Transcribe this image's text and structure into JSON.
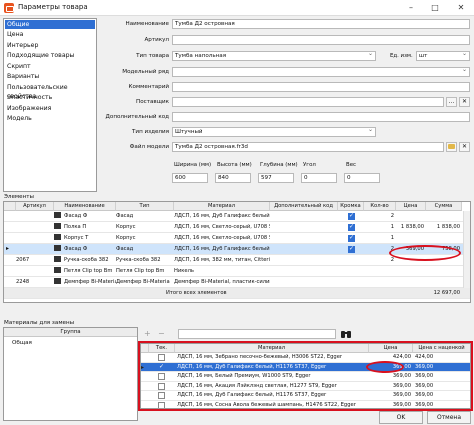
{
  "window": {
    "title": "Параметры товара",
    "minimize": "–",
    "maximize": "□",
    "close": "✕"
  },
  "nav": {
    "items": [
      "Общие",
      "Цена",
      "Интерьер",
      "Подходящие товары",
      "Скрипт",
      "Варианты",
      "Пользовательские свойства",
      "Эластичность",
      "Изображения",
      "Модель"
    ],
    "selected": 0
  },
  "form": {
    "name_label": "Наименование",
    "name_value": "Тумба Д2 островная",
    "article_label": "Артикул",
    "article_value": "",
    "type_label": "Тип товара",
    "type_value": "Тумба напольная",
    "unit_label": "Ед. изм.",
    "unit_value": "шт",
    "model_row_label": "Модельный ряд",
    "model_row_value": "",
    "comment_label": "Комментарий",
    "comment_value": "",
    "supplier_label": "Поставщик",
    "supplier_value": "",
    "extra_article_label": "Дополнительный код",
    "extra_article_value": "",
    "product_kind_label": "Тип изделия",
    "product_kind_value": "Штучный",
    "model_file_label": "Файл модели",
    "model_file_value": "Тумба Д2 островная.fr3d",
    "dims": [
      {
        "label": "Ширина (мм)",
        "value": "600"
      },
      {
        "label": "Высота (мм)",
        "value": "840"
      },
      {
        "label": "Глубина (мм)",
        "value": "597"
      },
      {
        "label": "Угол",
        "value": "0"
      },
      {
        "label": "Вес",
        "value": "0"
      }
    ],
    "more_btn": "...",
    "clear_btn": "✕"
  },
  "elements": {
    "section_label": "Элементы",
    "columns": [
      "Артикул",
      "Наименование",
      "Тип",
      "Материал",
      "Дополнительный код",
      "Кромка",
      "Кол-во",
      "Цена",
      "Сумма"
    ],
    "rows": [
      {
        "article": "",
        "name": "Фасад Ф",
        "type": "Фасад",
        "material": "ЛДСП, 16 мм, Дуб Галифакс белый, H1176",
        "extra": "",
        "edge": true,
        "qty": "2",
        "price": "",
        "sum": ""
      },
      {
        "article": "",
        "name": "Полка П",
        "type": "Корпус",
        "material": "ЛДСП, 16 мм, Светло-серый, U708 ST9,",
        "extra": "",
        "edge": true,
        "qty": "1",
        "price": "1 838,00",
        "sum": "1 838,00"
      },
      {
        "article": "",
        "name": "Корпус Т",
        "type": "Корпус",
        "material": "ЛДСП, 16 мм, Светло-серый, U708 ST9,",
        "extra": "",
        "edge": true,
        "qty": "1",
        "price": "",
        "sum": ""
      },
      {
        "article": "",
        "name": "Фасад Ф",
        "type": "Фасад",
        "material": "ЛДСП, 16 мм, Дуб Галифакс белый, H1176",
        "extra": "",
        "edge": true,
        "qty": "2",
        "price": "369,00",
        "sum": "738,00"
      },
      {
        "article": "2067",
        "name": "Ручка-скоба 382",
        "type": "Ручка-скоба 382",
        "material": "ЛДСП, 16 мм, 382 мм, титан, Citterio",
        "extra": "",
        "edge": false,
        "qty": "2",
        "price": "",
        "sum": ""
      },
      {
        "article": "",
        "name": "Петля Clip top Bm",
        "type": "Петля Clip top Bm",
        "material": "Никель",
        "extra": "",
        "edge": false,
        "qty": "",
        "price": "",
        "sum": ""
      },
      {
        "article": "2248",
        "name": "Демпфер Bi-Materia",
        "type": "Демпфер Bi-Materia",
        "material": "Демпфер Bi-Material, пластик-силикон,",
        "extra": "",
        "edge": false,
        "qty": "",
        "price": "",
        "sum": ""
      }
    ],
    "selected_row": 3,
    "total_label": "Итого всех элементов",
    "total_value": "12 697,00"
  },
  "materials": {
    "section_label": "Материалы для замены",
    "group_header": "Группа",
    "group_value": "Общая",
    "add_icon": "+",
    "remove_icon": "−",
    "columns": [
      "Тек.",
      "Материал",
      "Цена",
      "Цена с наценкой"
    ],
    "rows": [
      {
        "current": false,
        "material": "ЛДСП, 16 мм, Зебрано песочно-бежевый, H3006 ST22, Egger",
        "price": "424,00",
        "price_markup": "424,00"
      },
      {
        "current": true,
        "material": "ЛДСП, 16 мм, Дуб Галифакс белый, H1176 ST37, Egger",
        "price": "369,00",
        "price_markup": "369,00"
      },
      {
        "current": false,
        "material": "ЛДСП, 16 мм, Белый Премиум, W1000 ST9, Egger",
        "price": "369,00",
        "price_markup": "369,00"
      },
      {
        "current": false,
        "material": "ЛДСП, 16 мм, Акация Лэйклэнд светлая, H1277 ST9, Egger",
        "price": "369,00",
        "price_markup": "369,00"
      },
      {
        "current": false,
        "material": "ЛДСП, 16 мм, Дуб Галифакс белый, H1176 ST37, Egger",
        "price": "369,00",
        "price_markup": "369,00"
      },
      {
        "current": false,
        "material": "ЛДСП, 16 мм, Сосна Авола бежевый шампань, H1476 ST22, Egger",
        "price": "369,00",
        "price_markup": "369,00"
      }
    ],
    "selected_row": 1
  },
  "buttons": {
    "ok": "OK",
    "cancel": "Отмена"
  },
  "colors": {
    "accent": "#2f6fd3",
    "annotation": "#d8101e",
    "selection": "#cfe4fb"
  }
}
